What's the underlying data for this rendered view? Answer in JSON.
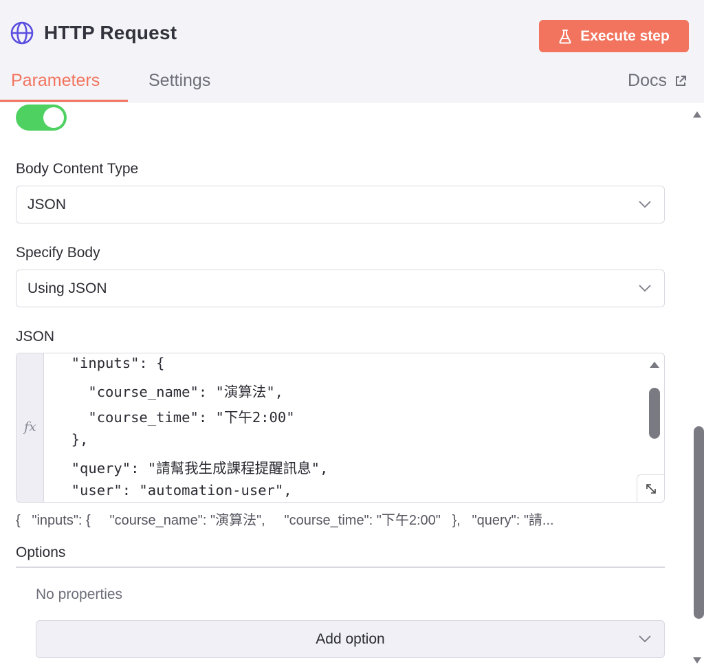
{
  "header": {
    "title": "HTTP Request",
    "execute_label": "Execute step",
    "tabs": [
      {
        "label": "Parameters",
        "active": true
      },
      {
        "label": "Settings",
        "active": false
      }
    ],
    "docs_label": "Docs"
  },
  "body": {
    "send_body_enabled": true,
    "content_type_label": "Body Content Type",
    "content_type_value": "JSON",
    "specify_body_label": "Specify Body",
    "specify_body_value": "Using JSON",
    "json_label": "JSON",
    "json_lines": [
      "  \"inputs\": {",
      "    \"course_name\": \"演算法\",",
      "    \"course_time\": \"下午2:00\"",
      "  },",
      "  \"query\": \"請幫我生成課程提醒訊息\",",
      "  \"user\": \"automation-user\","
    ],
    "json_preview": "{   \"inputs\": {     \"course_name\": \"演算法\",     \"course_time\": \"下午2:00\"   },   \"query\": \"請...",
    "fx_label": "fx"
  },
  "options": {
    "label": "Options",
    "empty_text": "No properties",
    "add_label": "Add option"
  },
  "colors": {
    "accent": "#f2735e",
    "toggle_on": "#4fd162",
    "globe": "#5b4fe0"
  }
}
